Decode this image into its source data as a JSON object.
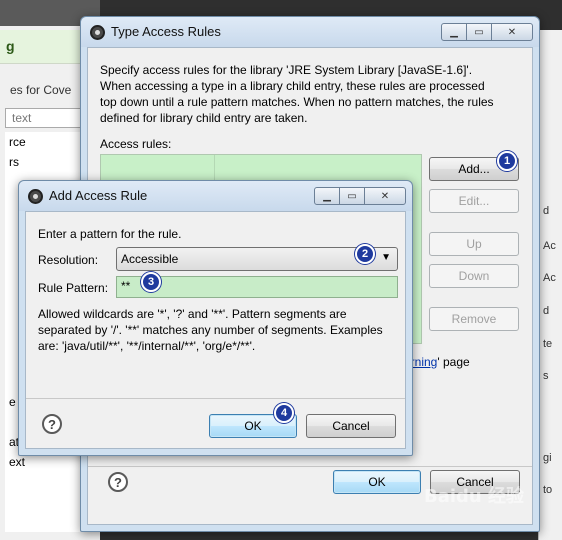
{
  "background": {
    "header_char": "g",
    "panel_label": "es for Cove",
    "filter_placeholder": "text",
    "list_items": [
      "rce",
      "rs",
      "",
      "",
      "",
      "",
      "",
      "",
      "",
      "",
      "",
      "",
      "",
      "e",
      "",
      "ation",
      "ext"
    ],
    "right_fragments": [
      "d",
      "Ac",
      "Ac",
      "d",
      "te",
      "s",
      "gi",
      "to"
    ]
  },
  "type_access_rules": {
    "title": "Type Access Rules",
    "description": "Specify access rules for the library 'JRE System Library [JavaSE-1.6]'. When accessing a type in a library child entry, these rules are processed top down until a rule pattern matches. When no pattern matches, the rules defined for library child entry are taken.",
    "access_rules_label": "Access rules:",
    "buttons": {
      "add": "Add...",
      "edit": "Edit...",
      "up": "Up",
      "down": "Down",
      "remove": "Remove",
      "ok": "OK",
      "cancel": "Cancel"
    },
    "link_text": "arning",
    "link_suffix": "' page"
  },
  "add_access_rule": {
    "title": "Add Access Rule",
    "prompt": "Enter a pattern for the rule.",
    "resolution_label": "Resolution:",
    "resolution_value": "Accessible",
    "rule_pattern_label": "Rule Pattern:",
    "rule_pattern_value": "**",
    "help_text": "Allowed wildcards are '*', '?' and '**'. Pattern segments are separated by '/'. '**' matches any number of segments. Examples are: 'java/util/**', '**/internal/**', 'org/e*/**'.",
    "buttons": {
      "ok": "OK",
      "cancel": "Cancel"
    }
  },
  "step_badges": [
    "1",
    "2",
    "3",
    "4"
  ],
  "watermark": "Baidu 经验",
  "colors": {
    "list_bg": "#c8f0c8",
    "focus_green": "#c8ecc8",
    "badge": "#1f3a9e"
  }
}
